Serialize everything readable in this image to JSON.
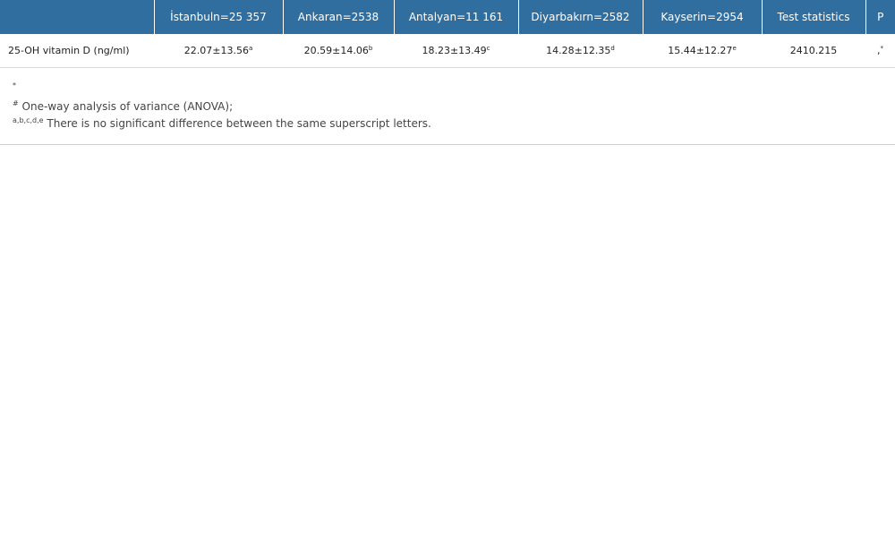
{
  "table": {
    "headers": [
      "",
      "İstanbuln=25 357",
      "Ankaran=2538",
      "Antalyan=11 161",
      "Diyarbakırn=2582",
      "Kayserin=2954",
      "Test statistics",
      "P"
    ],
    "row": {
      "label": "25-OH vitamin D (ng/ml)",
      "cells": [
        {
          "value": "22.07±13.56",
          "sup": "a"
        },
        {
          "value": "20.59±14.06",
          "sup": "b"
        },
        {
          "value": "18.23±13.49",
          "sup": "c"
        },
        {
          "value": "14.28±12.35",
          "sup": "d"
        },
        {
          "value": "15.44±12.27",
          "sup": "e"
        }
      ],
      "test_statistic": "2410.215",
      "p_value": ",",
      "p_sup": "*"
    }
  },
  "notes": {
    "star_marker": "*",
    "hash_marker": "#",
    "hash_text": "One-way analysis of variance (ANOVA);",
    "letters_marker": "a,b,c,d,e",
    "letters_text": "There is no significant difference between the same superscript letters."
  },
  "colors": {
    "header_bg": "#2f6e9f",
    "header_text": "#ffffff"
  }
}
